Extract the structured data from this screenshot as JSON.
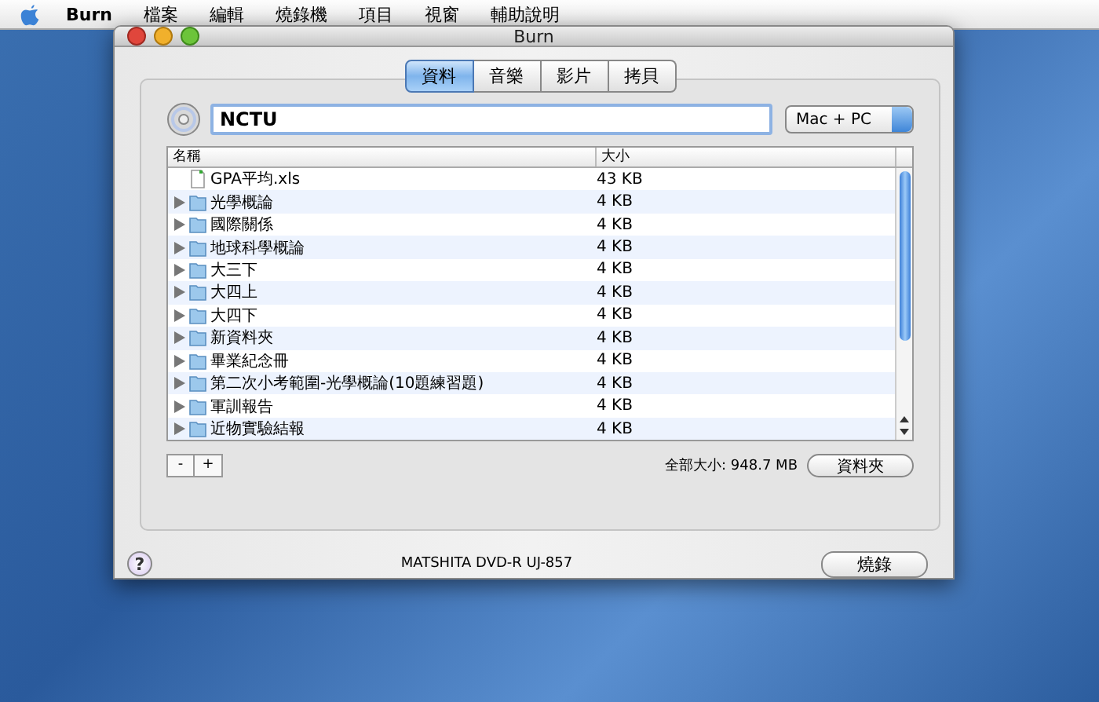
{
  "menu_bar": {
    "app_name": "Burn",
    "items": [
      "檔案",
      "編輯",
      "燒錄機",
      "項目",
      "視窗",
      "輔助說明"
    ]
  },
  "window": {
    "title": "Burn"
  },
  "tabs": [
    {
      "label": "資料",
      "selected": true
    },
    {
      "label": "音樂",
      "selected": false
    },
    {
      "label": "影片",
      "selected": false
    },
    {
      "label": "拷貝",
      "selected": false
    }
  ],
  "disc_name": {
    "value": "NCTU"
  },
  "format_popup": {
    "value": "Mac + PC"
  },
  "table": {
    "columns": [
      "名稱",
      "大小"
    ],
    "rows": [
      {
        "kind": "file",
        "name": "GPA平均.xls",
        "size": "43 KB"
      },
      {
        "kind": "folder",
        "name": "光學概論",
        "size": "4 KB"
      },
      {
        "kind": "folder",
        "name": "國際關係",
        "size": "4 KB"
      },
      {
        "kind": "folder",
        "name": "地球科學概論",
        "size": "4 KB"
      },
      {
        "kind": "folder",
        "name": "大三下",
        "size": "4 KB"
      },
      {
        "kind": "folder",
        "name": "大四上",
        "size": "4 KB"
      },
      {
        "kind": "folder",
        "name": "大四下",
        "size": "4 KB"
      },
      {
        "kind": "folder",
        "name": "新資料夾",
        "size": "4 KB"
      },
      {
        "kind": "folder",
        "name": "畢業紀念冊",
        "size": "4 KB"
      },
      {
        "kind": "folder",
        "name": "第二次小考範圍-光學概論(10題練習題)",
        "size": "4 KB"
      },
      {
        "kind": "folder",
        "name": "軍訓報告",
        "size": "4 KB"
      },
      {
        "kind": "folder",
        "name": "近物實驗結報",
        "size": "4 KB"
      }
    ]
  },
  "list_buttons": [
    "-",
    "+"
  ],
  "total_size": "全部大小: 948.7 MB",
  "folder_button": "資料夾",
  "help_button": "?",
  "drive_name": "MATSHITA DVD-R UJ-857",
  "burn_button": "燒錄"
}
